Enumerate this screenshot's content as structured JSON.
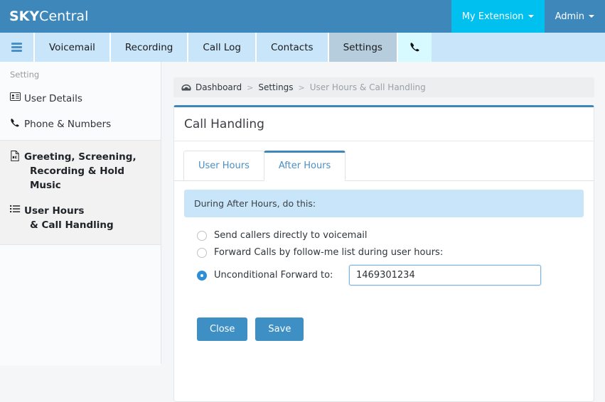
{
  "header": {
    "brand_strong": "SKY",
    "brand_light": "Central",
    "my_extension": "My Extension",
    "admin": "Admin"
  },
  "nav": {
    "menu_icon": "hamburger-icon",
    "items": [
      {
        "label": "Voicemail",
        "active": false
      },
      {
        "label": "Recording",
        "active": false
      },
      {
        "label": "Call Log",
        "active": false
      },
      {
        "label": "Contacts",
        "active": false
      },
      {
        "label": "Settings",
        "active": true
      }
    ],
    "phone_icon": "✆"
  },
  "sidebar": {
    "section_label": "Setting",
    "items": [
      {
        "icon": "id-card-icon",
        "label": "User Details",
        "line2": ""
      },
      {
        "icon": "phone-icon",
        "label": "Phone & Numbers",
        "line2": ""
      },
      {
        "icon": "audio-file-icon",
        "label": "Greeting, Screening,",
        "line2": "Recording & Hold Music"
      },
      {
        "icon": "list-icon",
        "label": "User Hours",
        "line2": "& Call Handling"
      }
    ]
  },
  "breadcrumb": {
    "icon": "dashboard-icon",
    "dashboard": "Dashboard",
    "sep1": ">",
    "settings": "Settings",
    "sep2": ">",
    "current": "User Hours & Call Handling"
  },
  "panel": {
    "title": "Call Handling",
    "tabs": [
      {
        "label": "User Hours",
        "active": false
      },
      {
        "label": "After Hours",
        "active": true
      }
    ],
    "notice": "During After Hours, do this:",
    "options": [
      {
        "label": "Send callers directly to voicemail",
        "checked": false
      },
      {
        "label": "Forward Calls by follow-me list during user hours:",
        "checked": false
      },
      {
        "label": "Unconditional Forward to:",
        "checked": true
      }
    ],
    "forward_input_value": "1469301234",
    "forward_input_placeholder": "",
    "close_button": "Close",
    "save_button": "Save"
  },
  "colors": {
    "header_blue": "#3d87bb",
    "accent_cyan": "#00c0ef",
    "nav_blue": "#c8e5fa",
    "nav_active": "#b6cdde",
    "phone_tab": "#d6faff",
    "button_blue": "#3d8fc4",
    "notice_blue": "#c8e5fa",
    "tab_text": "#4b8fc4"
  }
}
